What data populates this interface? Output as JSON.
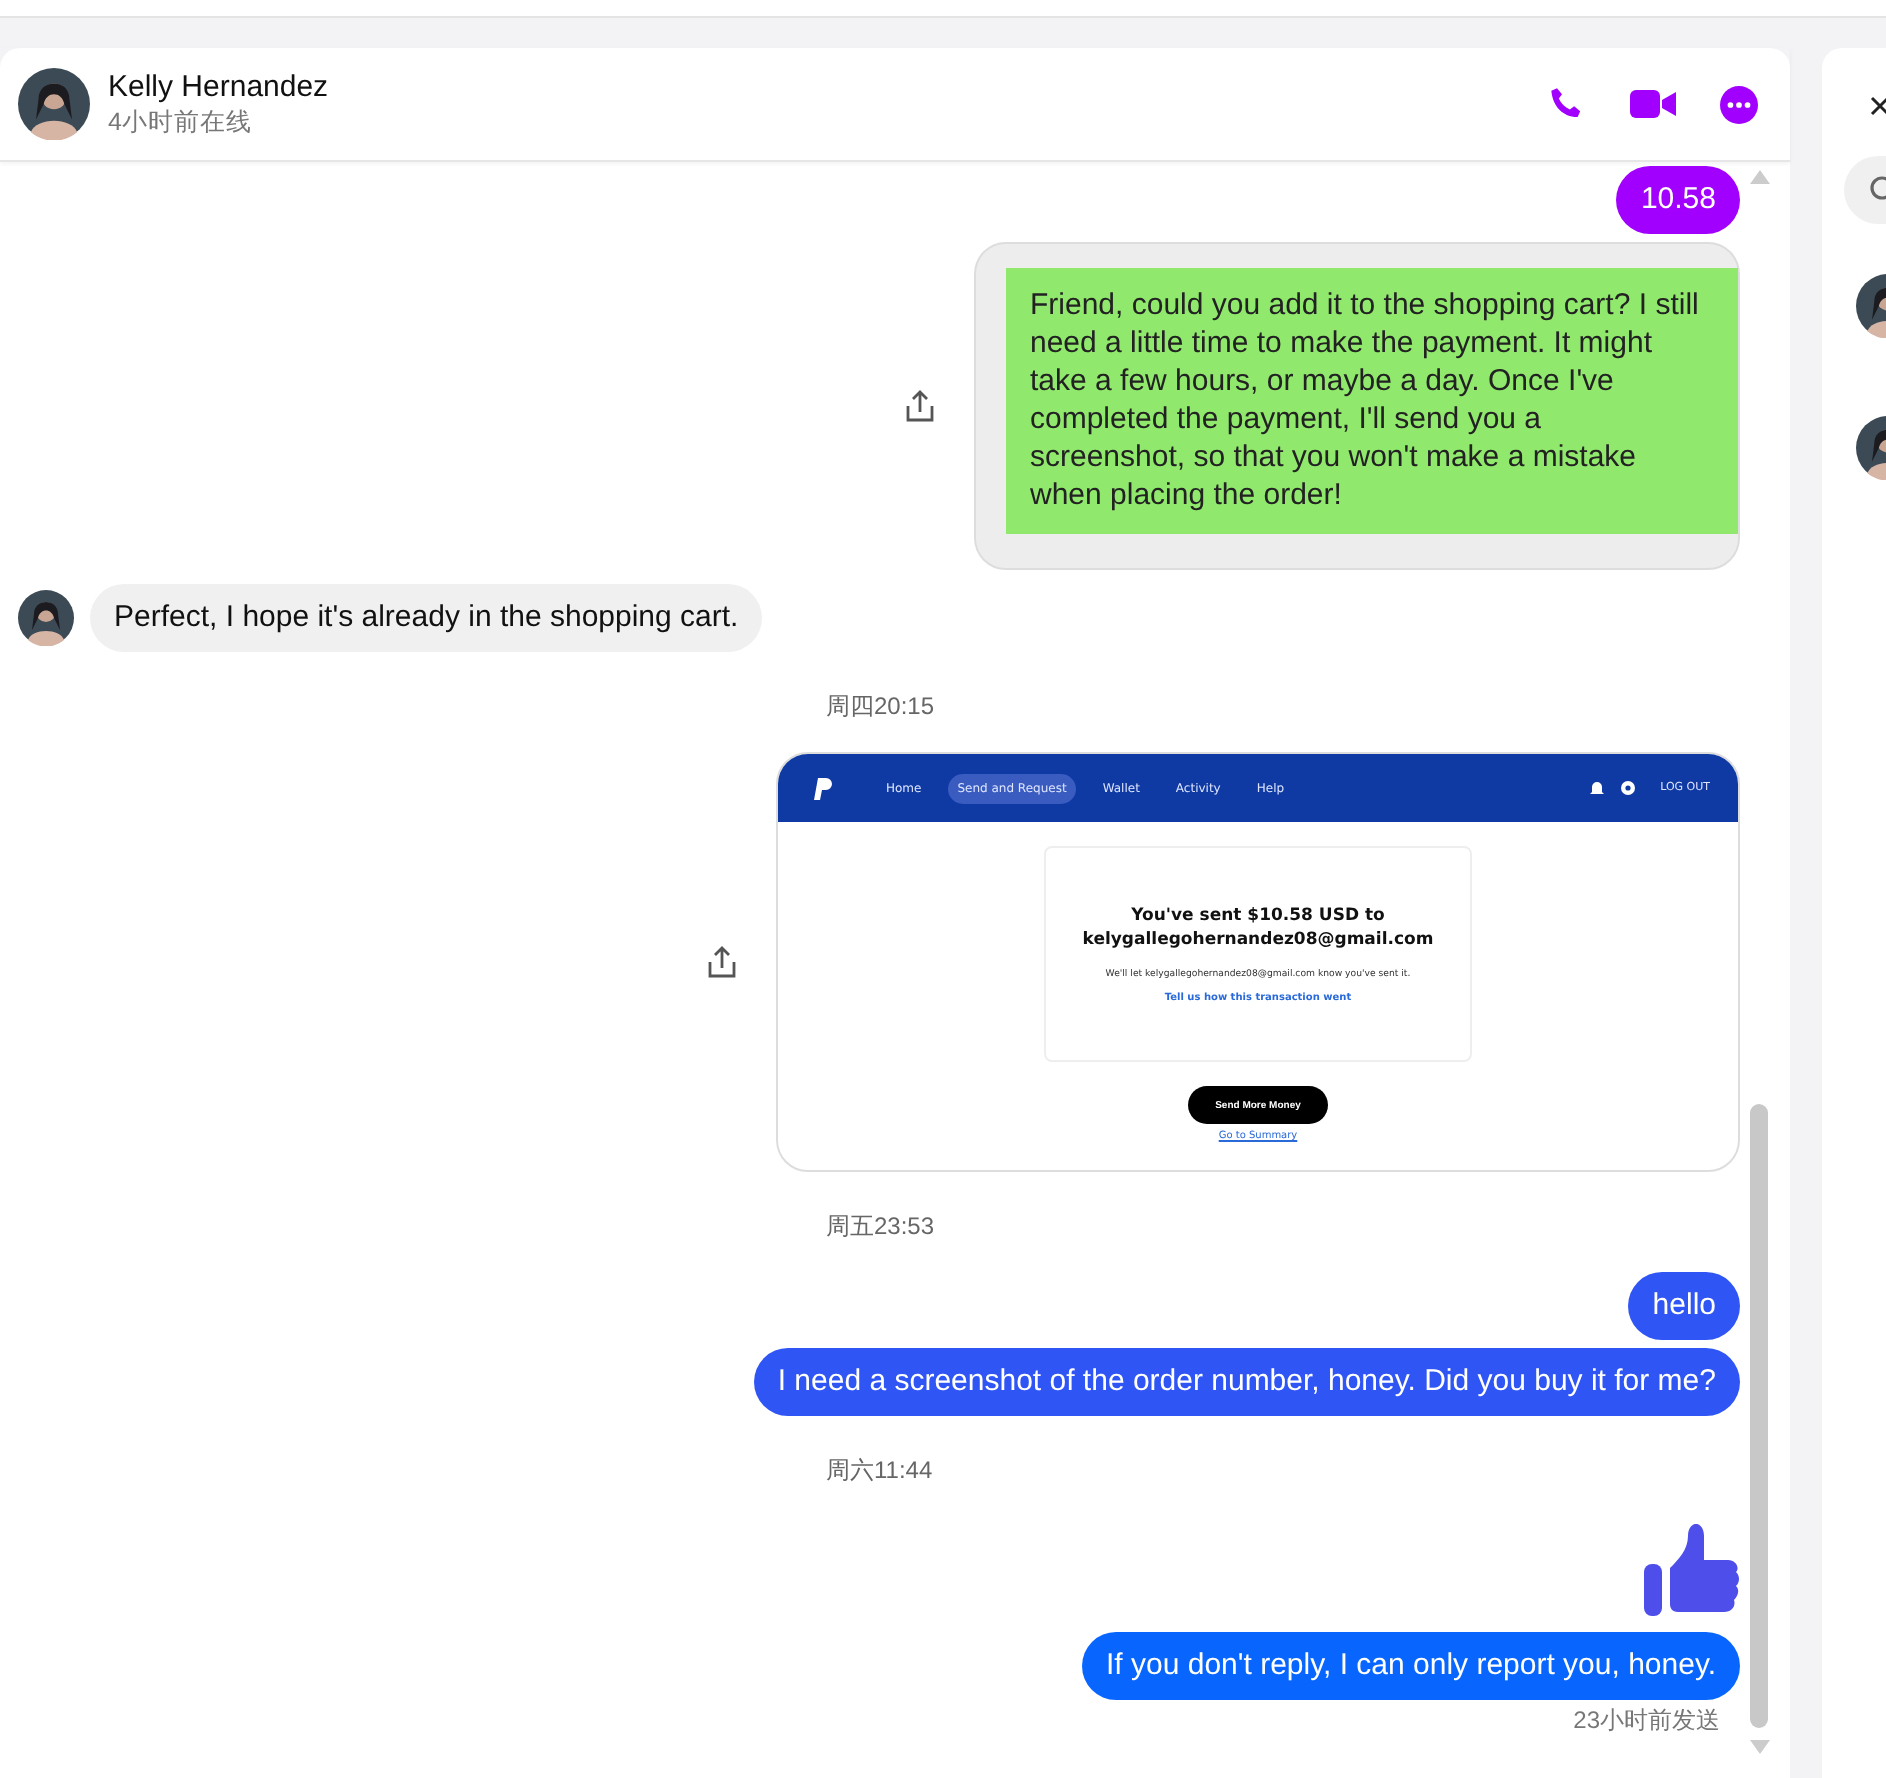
{
  "header": {
    "name": "Kelly Hernandez",
    "status": "4小时前在线"
  },
  "messages": [
    {
      "kind": "outgoing",
      "text": "10.58",
      "color": "#a100ff"
    },
    {
      "kind": "boxed",
      "text": "Friend, could you add it to the shopping cart? I still need a little time to make the payment. It might take a few hours, or maybe a day. Once I've completed the payment, I'll send you a screenshot, so that you won't make a mistake when placing the order!"
    },
    {
      "kind": "incoming",
      "text": "Perfect, I hope it's already in the shopping cart."
    },
    {
      "kind": "time",
      "text": "周四20:15"
    },
    {
      "kind": "screenshot",
      "nav": [
        {
          "label": "Home",
          "selected": false
        },
        {
          "label": "Send and Request",
          "selected": true
        },
        {
          "label": "Wallet",
          "selected": false
        },
        {
          "label": "Activity",
          "selected": false
        },
        {
          "label": "Help",
          "selected": false
        }
      ],
      "logout": "LOG OUT",
      "heading": [
        "You've sent $10.58 USD to",
        "kelygallegohernandez08@gmail.com"
      ],
      "note": "We'll let kelygallegohernandez08@gmail.com know you've sent it.",
      "link": "Tell us how this transaction went",
      "button": "Send More Money",
      "footer_link": "Go to Summary"
    },
    {
      "kind": "time",
      "text": "周五23:53"
    },
    {
      "kind": "outgoing",
      "text": "hello",
      "color": "#2f55f5"
    },
    {
      "kind": "outgoing",
      "text": "I need a screenshot of the order number, honey. Did you buy it for me?",
      "color": "#2f55f5"
    },
    {
      "kind": "time",
      "text": "周六11:44"
    },
    {
      "kind": "like"
    },
    {
      "kind": "outgoing",
      "text": "If you don't reply, I can only report you, honey.",
      "color": "#0866ff"
    },
    {
      "kind": "status",
      "text": "23小时前发送"
    }
  ]
}
